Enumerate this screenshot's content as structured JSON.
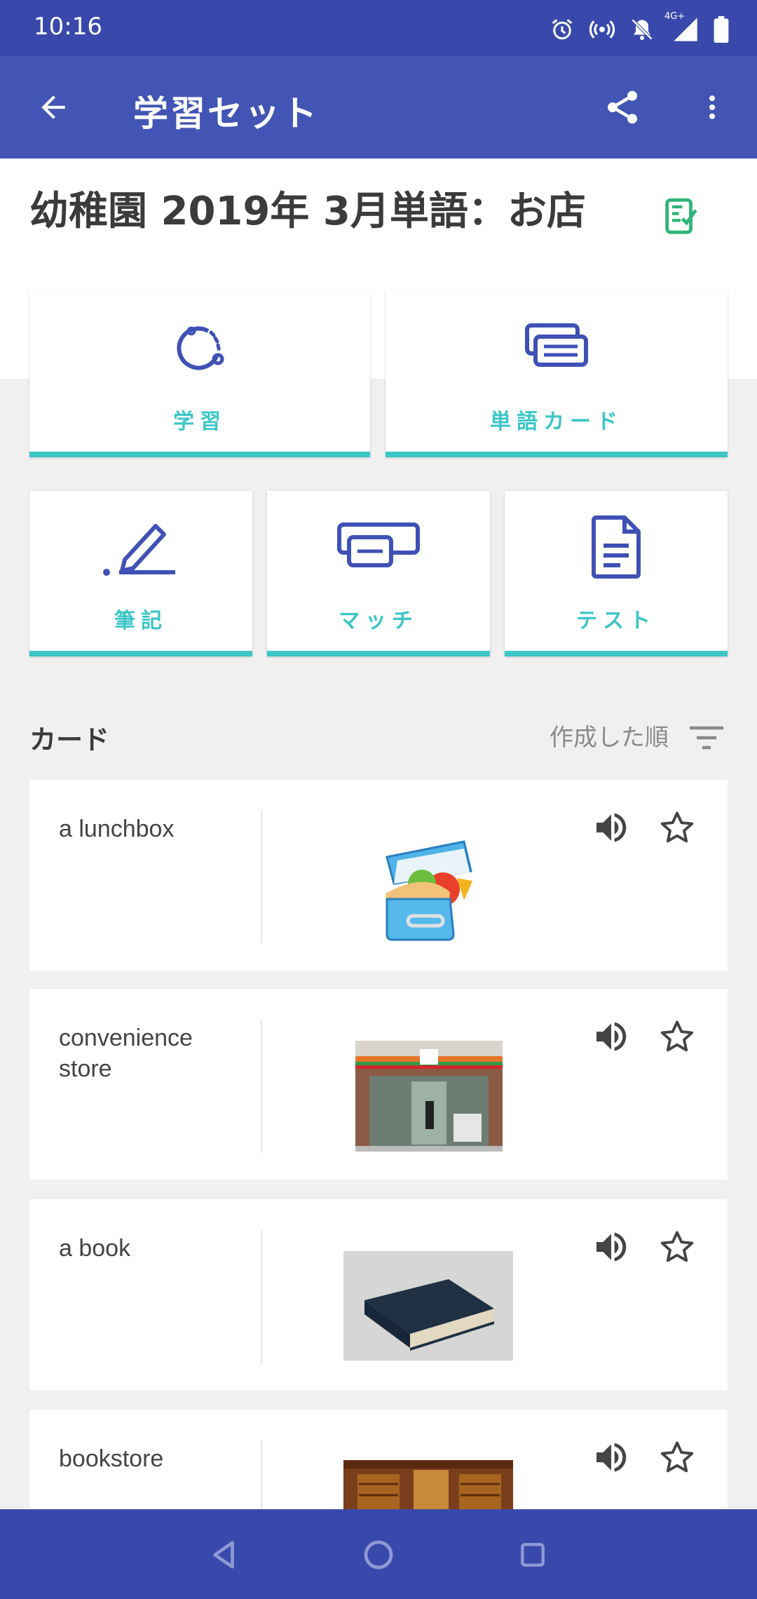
{
  "status_bar": {
    "time": "10:16",
    "network_label": "4G+",
    "icons": [
      "alarm-icon",
      "hotspot-icon",
      "notifications-off-icon",
      "signal-icon",
      "battery-icon"
    ]
  },
  "app_bar": {
    "title": "学習セット",
    "icons": [
      "back-arrow-icon",
      "share-icon",
      "more-vert-icon"
    ]
  },
  "set": {
    "title": "幼稚園 2019年 3月単語：お店",
    "title_icon": "checklist-icon"
  },
  "modes": [
    {
      "label": "学習",
      "icon": "learn-icon"
    },
    {
      "label": "単語カード",
      "icon": "flashcards-icon"
    },
    {
      "label": "筆記",
      "icon": "write-icon"
    },
    {
      "label": "マッチ",
      "icon": "match-icon"
    },
    {
      "label": "テスト",
      "icon": "test-icon"
    }
  ],
  "cards_section": {
    "title": "カード",
    "sort_label": "作成した順",
    "sort_icon": "sort-icon"
  },
  "cards": [
    {
      "term": "a lunchbox",
      "image": "lunchbox-image"
    },
    {
      "term": "convenience store",
      "image": "convenience-store-image"
    },
    {
      "term": "a book",
      "image": "book-image"
    },
    {
      "term": "bookstore",
      "image": "bookstore-image"
    }
  ],
  "nav_bar": {
    "icons": [
      "nav-back-icon",
      "nav-home-icon",
      "nav-recents-icon"
    ]
  },
  "colors": {
    "primary": "#4255b4",
    "status_bar": "#3949ab",
    "accent": "#3cc6c6",
    "icon": "#3f51b5",
    "check_green": "#2fb57a"
  }
}
